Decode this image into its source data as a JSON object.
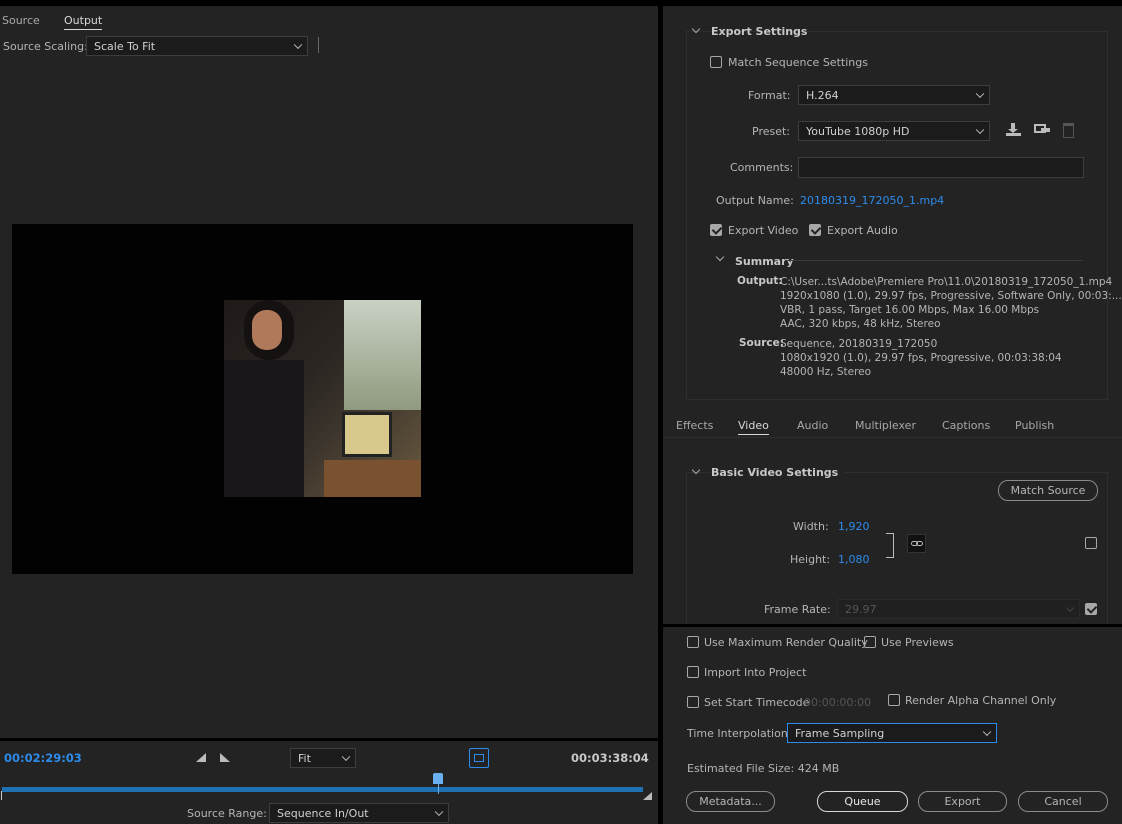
{
  "left": {
    "tabs": [
      "Source",
      "Output"
    ],
    "source_scaling_label": "Source Scaling:",
    "source_scaling_value": "Scale To Fit",
    "timecode_current": "00:02:29:03",
    "timecode_total": "00:03:38:04",
    "zoom_value": "Fit",
    "source_range_label": "Source Range:",
    "source_range_value": "Sequence In/Out",
    "playhead_fraction": 0.68
  },
  "export_settings": {
    "title": "Export Settings",
    "match_sequence": "Match Sequence Settings",
    "format_label": "Format:",
    "format_value": "H.264",
    "preset_label": "Preset:",
    "preset_value": "YouTube 1080p HD",
    "comments_label": "Comments:",
    "comments_value": "",
    "output_name_label": "Output Name:",
    "output_name_value": "20180319_172050_1.mp4",
    "export_video": "Export Video",
    "export_audio": "Export Audio",
    "summary_title": "Summary",
    "output_label": "Output:",
    "output_lines": "C:\\User...ts\\Adobe\\Premiere Pro\\11.0\\20180319_172050_1.mp4\n1920x1080 (1.0), 29.97 fps, Progressive, Software Only, 00:03:...\nVBR, 1 pass, Target 16.00 Mbps, Max 16.00 Mbps\nAAC, 320 kbps, 48 kHz, Stereo",
    "source_label": "Source:",
    "source_lines": "Sequence, 20180319_172050\n1080x1920 (1.0), 29.97 fps, Progressive, 00:03:38:04\n48000 Hz, Stereo"
  },
  "tabs": {
    "effects": "Effects",
    "video": "Video",
    "audio": "Audio",
    "multiplexer": "Multiplexer",
    "captions": "Captions",
    "publish": "Publish"
  },
  "video": {
    "section_title": "Basic Video Settings",
    "match_source": "Match Source",
    "width_label": "Width:",
    "width_value": "1,920",
    "height_label": "Height:",
    "height_value": "1,080",
    "frame_rate_label": "Frame Rate:",
    "frame_rate_value": "29.97"
  },
  "bottom": {
    "max_render": "Use Maximum Render Quality",
    "use_previews": "Use Previews",
    "import_project": "Import Into Project",
    "set_start_tc": "Set Start Timecode",
    "start_tc_value": "00:00:00:00",
    "render_alpha": "Render Alpha Channel Only",
    "time_interp_label": "Time Interpolation:",
    "time_interp_value": "Frame Sampling",
    "file_size": "Estimated File Size:  424 MB",
    "metadata": "Metadata...",
    "queue": "Queue",
    "export": "Export",
    "cancel": "Cancel"
  }
}
